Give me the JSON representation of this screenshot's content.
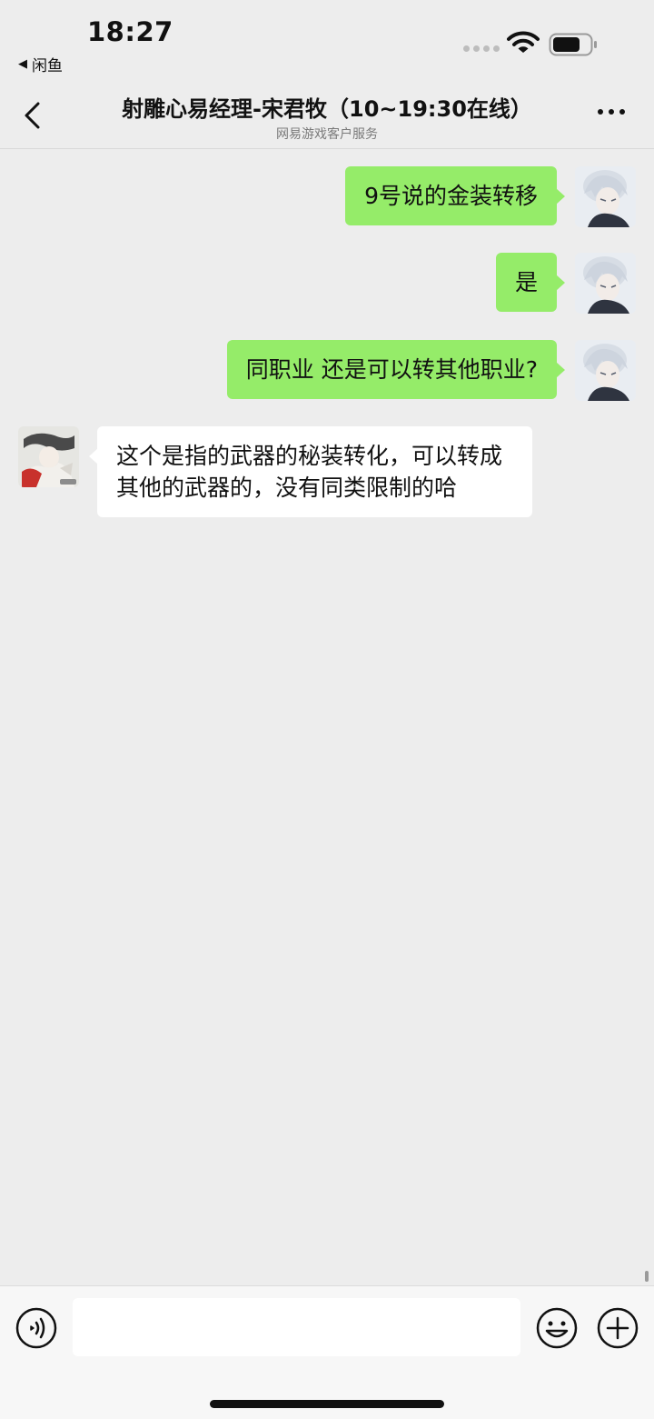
{
  "status_bar": {
    "time": "18:27",
    "back_app_label": "闲鱼",
    "back_arrow_glyph": "◀"
  },
  "nav": {
    "title": "射雕心易经理-宋君牧（10~19:30在线）",
    "subtitle": "网易游戏客户服务"
  },
  "messages": [
    {
      "sender": "self",
      "text": "9号说的金装转移"
    },
    {
      "sender": "self",
      "text": "是"
    },
    {
      "sender": "self",
      "text": "同职业 还是可以转其他职业?"
    },
    {
      "sender": "other",
      "text": "这个是指的武器的秘装转化，可以转成其他的武器的，没有同类限制的哈"
    }
  ],
  "input": {
    "value": "",
    "placeholder": ""
  },
  "colors": {
    "self_bubble": "#95ec69",
    "other_bubble": "#ffffff",
    "background": "#ededed"
  },
  "icons": {
    "back": "chevron-left-icon",
    "more": "more-dots-icon",
    "voice": "voice-icon",
    "emoji": "emoji-icon",
    "add": "plus-circle-icon"
  }
}
